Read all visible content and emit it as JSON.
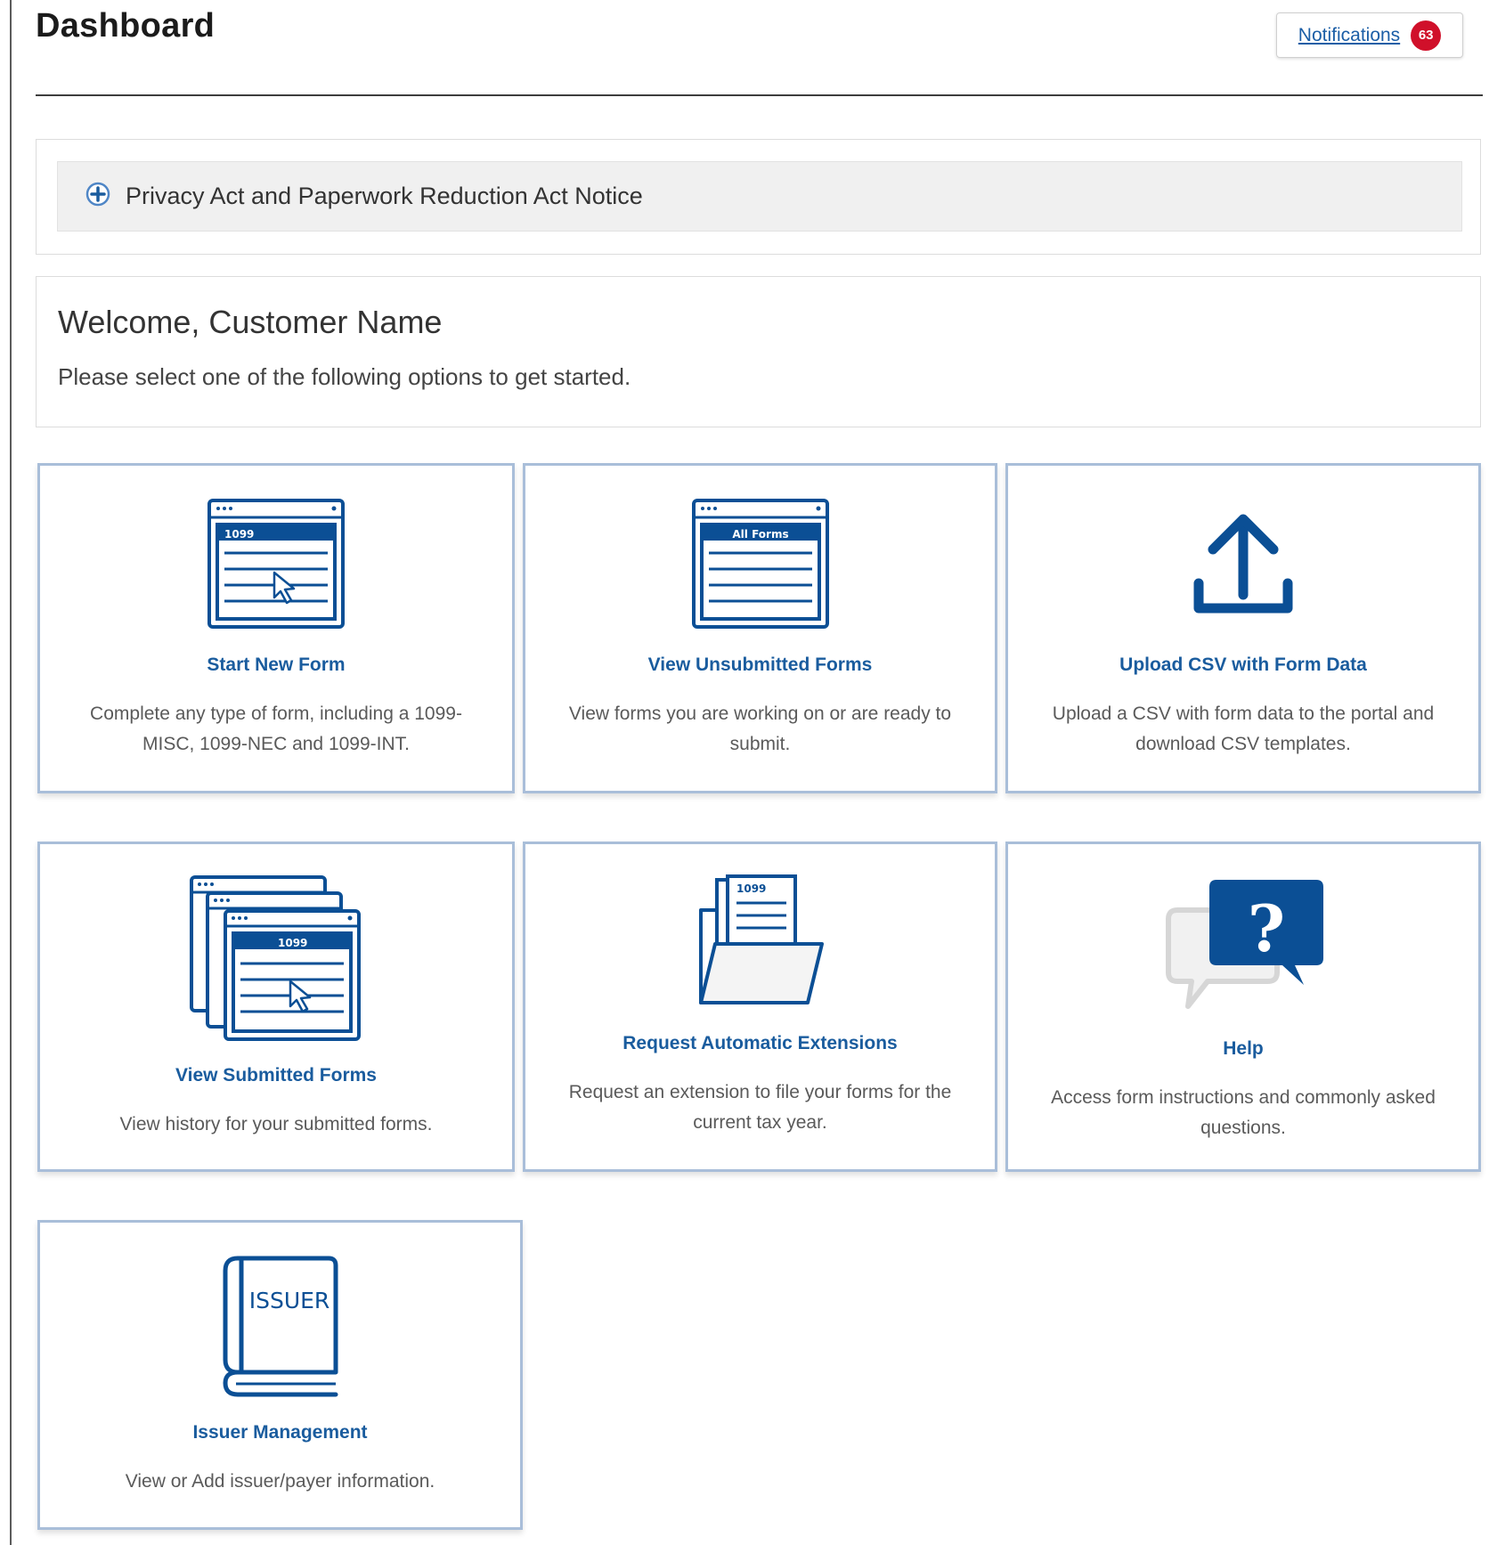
{
  "header": {
    "title": "Dashboard",
    "notifications_label": "Notifications",
    "notifications_count": "63"
  },
  "privacy": {
    "label": "Privacy Act and Paperwork Reduction Act Notice",
    "icon": "plus-circle-icon"
  },
  "welcome": {
    "title": "Welcome, Customer Name",
    "subtitle": "Please select one of the following options to get started."
  },
  "cards": [
    {
      "title": "Start New Form",
      "description": "Complete any type of form, including a 1099-MISC, 1099-NEC and 1099-INT.",
      "icon": "new-form-icon",
      "icon_label": "1099"
    },
    {
      "title": "View Unsubmitted Forms",
      "description": "View forms you are working on or are ready to submit.",
      "icon": "all-forms-icon",
      "icon_label": "All Forms"
    },
    {
      "title": "Upload CSV with Form Data",
      "description": "Upload a CSV with form data to the portal and download CSV templates.",
      "icon": "upload-icon"
    },
    {
      "title": "View Submitted Forms",
      "description": "View history for your submitted forms.",
      "icon": "submitted-forms-icon",
      "icon_label": "1099"
    },
    {
      "title": "Request Automatic Extensions",
      "description": "Request an extension to file your forms for the current tax year.",
      "icon": "folder-icon",
      "icon_label": "1099"
    },
    {
      "title": "Help",
      "description": "Access form instructions and commonly asked questions.",
      "icon": "help-icon",
      "icon_label": "?"
    },
    {
      "title": "Issuer Management",
      "description": "View or Add issuer/payer information.",
      "icon": "issuer-book-icon",
      "icon_label": "ISSUER"
    }
  ],
  "colors": {
    "accent": "#1a5c9e",
    "icon_blue": "#0b4f95",
    "card_border": "#a9bed9",
    "badge": "#d0102a"
  }
}
